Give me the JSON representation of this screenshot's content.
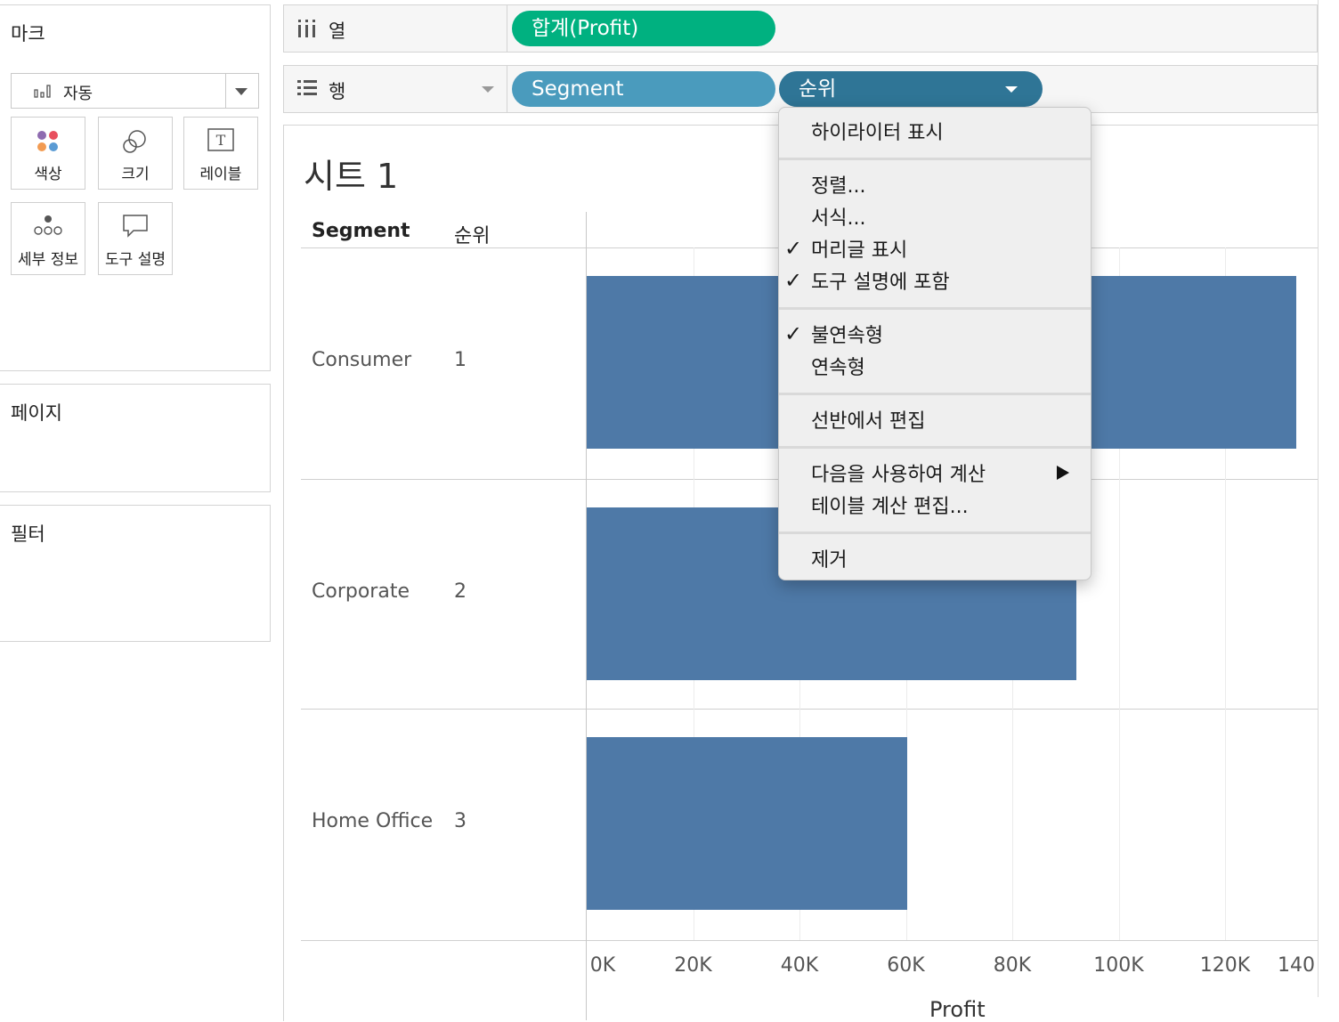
{
  "marks": {
    "title": "마크",
    "type_value": "자동",
    "cards": [
      "색상",
      "크기",
      "레이블",
      "세부 정보",
      "도구 설명"
    ]
  },
  "pages": {
    "title": "페이지"
  },
  "filters": {
    "title": "필터"
  },
  "columns_shelf": {
    "label": "열",
    "pill": "합계(Profit)"
  },
  "rows_shelf": {
    "label": "행",
    "pills": [
      "Segment",
      "순위"
    ]
  },
  "sheet": {
    "title": "시트 1",
    "headers": [
      "Segment",
      "순위"
    ],
    "x_axis_label": "Profit",
    "ticks": [
      "0K",
      "20K",
      "40K",
      "60K",
      "80K",
      "100K",
      "120K",
      "140"
    ]
  },
  "context_menu": {
    "items": [
      {
        "label": "하이라이터 표시",
        "checked": false
      },
      {
        "label": "정렬...",
        "checked": false
      },
      {
        "label": "서식...",
        "checked": false
      },
      {
        "label": "머리글 표시",
        "checked": true
      },
      {
        "label": "도구 설명에 포함",
        "checked": true
      },
      {
        "label": "불연속형",
        "checked": true
      },
      {
        "label": "연속형",
        "checked": false
      },
      {
        "label": "선반에서 편집",
        "checked": false
      },
      {
        "label": "다음을 사용하여 계산",
        "checked": false,
        "submenu": true
      },
      {
        "label": "테이블 계산 편집...",
        "checked": false
      },
      {
        "label": "제거",
        "checked": false
      }
    ]
  },
  "chart_data": {
    "type": "bar",
    "orientation": "horizontal",
    "categories": [
      "Consumer",
      "Corporate",
      "Home Office"
    ],
    "ranks": [
      "1",
      "2",
      "3"
    ],
    "values": [
      134000,
      92000,
      60300
    ],
    "xlabel": "Profit",
    "xlim": [
      0,
      140000
    ],
    "tick_values": [
      0,
      20000,
      40000,
      60000,
      80000,
      100000,
      120000,
      140000
    ],
    "bar_color": "#4e79a7",
    "grid": true
  },
  "colors": {
    "profit_pill": "#00b180",
    "segment_pill": "#4a9bbd",
    "rank_pill": "#2f7596",
    "bar": "#4e79a7"
  }
}
